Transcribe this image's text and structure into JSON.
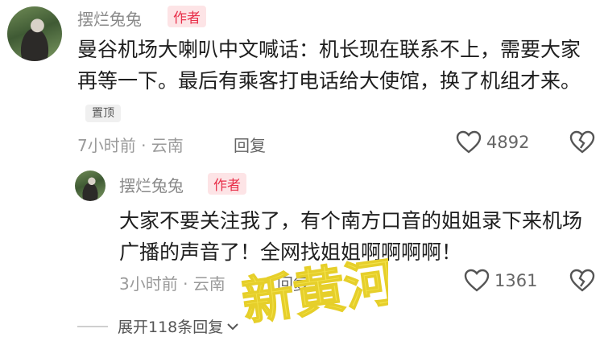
{
  "comments": [
    {
      "username": "摆烂兔兔",
      "author_tag": "作者",
      "content": "曼谷机场大喇叭中文喊话：机长现在联系不上，需要大家再等一下。最后有乘客打电话给大使馆，换了机组才来。",
      "pin_tag": "置顶",
      "meta": "7小时前 · 云南",
      "reply_label": "回复",
      "like_count": "4892"
    },
    {
      "username": "摆烂兔兔",
      "author_tag": "作者",
      "content": "大家不要关注我了，有个南方口音的姐姐录下来机场广播的声音了！全网找姐姐啊啊啊啊！",
      "meta": "3小时前 · 云南",
      "reply_label": "回复",
      "like_count": "1361"
    }
  ],
  "expand_replies": "展开118条回复",
  "watermark_text": "新黄河",
  "icons": {
    "like": "heart-outline-icon",
    "dislike": "broken-heart-icon",
    "expand": "chevron-down-icon"
  },
  "colors": {
    "author_tag_bg": "#fde4e6",
    "author_tag_text": "#e8304a",
    "watermark": "#f3e24a"
  }
}
